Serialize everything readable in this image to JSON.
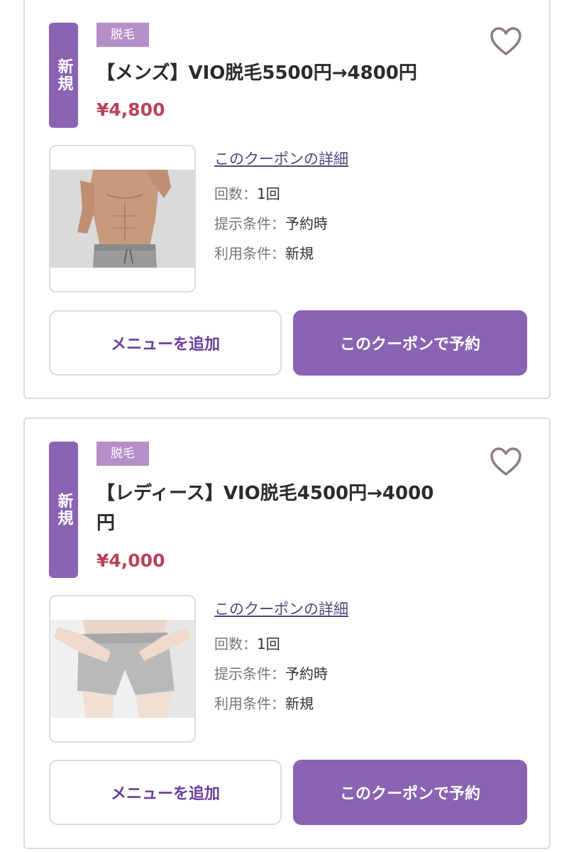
{
  "coupons": [
    {
      "badge": "新規",
      "category": "脱毛",
      "title": "【メンズ】VIO脱毛5500円→4800円",
      "price": "¥4,800",
      "detail_link": "このクーポンの詳細",
      "details": [
        {
          "key": "回数：",
          "value": "1回"
        },
        {
          "key": "提示条件：",
          "value": "予約時"
        },
        {
          "key": "利用条件：",
          "value": "新規"
        }
      ],
      "add_menu_label": "メニューを追加",
      "reserve_label": "このクーポンで予約"
    },
    {
      "badge": "新規",
      "category": "脱毛",
      "title": "【レディース】VIO脱毛4500円→4000円",
      "price": "¥4,000",
      "detail_link": "このクーポンの詳細",
      "details": [
        {
          "key": "回数：",
          "value": "1回"
        },
        {
          "key": "提示条件：",
          "value": "予約時"
        },
        {
          "key": "利用条件：",
          "value": "新規"
        }
      ],
      "add_menu_label": "メニューを追加",
      "reserve_label": "このクーポンで予約"
    }
  ],
  "colors": {
    "accent": "#8a63b3",
    "tag": "#b68ec8",
    "price": "#b8425a",
    "heart": "#8a7f7f"
  },
  "icons": [
    "heart-outline-icon"
  ]
}
